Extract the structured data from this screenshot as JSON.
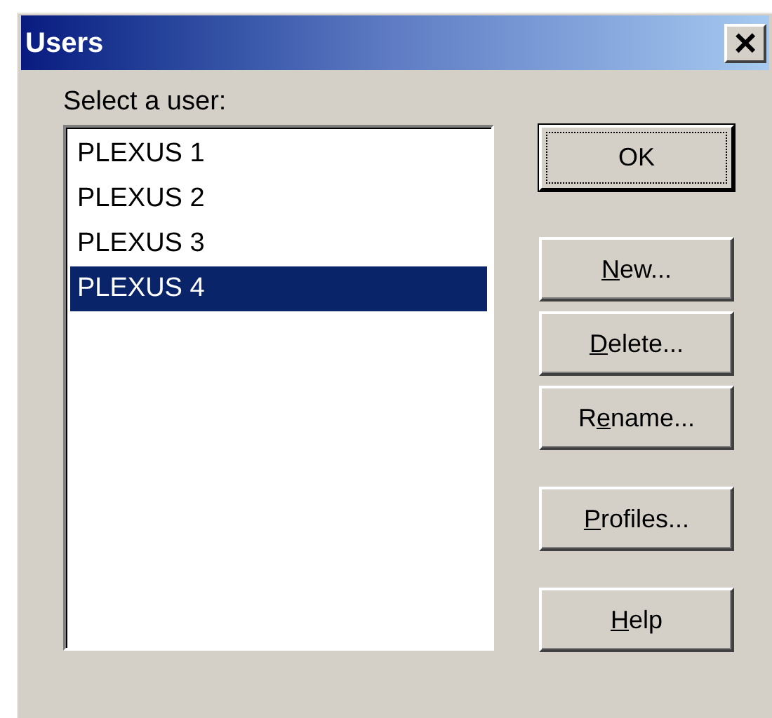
{
  "window": {
    "title": "Users",
    "close_label": "×"
  },
  "prompt": "Select a user:",
  "users": [
    {
      "name": "PLEXUS 1",
      "selected": false
    },
    {
      "name": "PLEXUS 2",
      "selected": false
    },
    {
      "name": "PLEXUS 3",
      "selected": false
    },
    {
      "name": "PLEXUS 4",
      "selected": true
    }
  ],
  "button_groups": [
    {
      "buttons": [
        {
          "rest": "OK",
          "default": true
        }
      ]
    },
    {
      "buttons": [
        {
          "access_key": "N",
          "rest": "ew...",
          "default": false
        },
        {
          "access_key": "D",
          "rest": "elete...",
          "default": false
        },
        {
          "lead": "R",
          "access_key": "e",
          "rest": "name...",
          "default": false
        }
      ]
    },
    {
      "buttons": [
        {
          "access_key": "P",
          "rest": "rofiles...",
          "default": false
        }
      ]
    },
    {
      "buttons": [
        {
          "access_key": "H",
          "rest": "elp",
          "default": false
        }
      ]
    }
  ]
}
